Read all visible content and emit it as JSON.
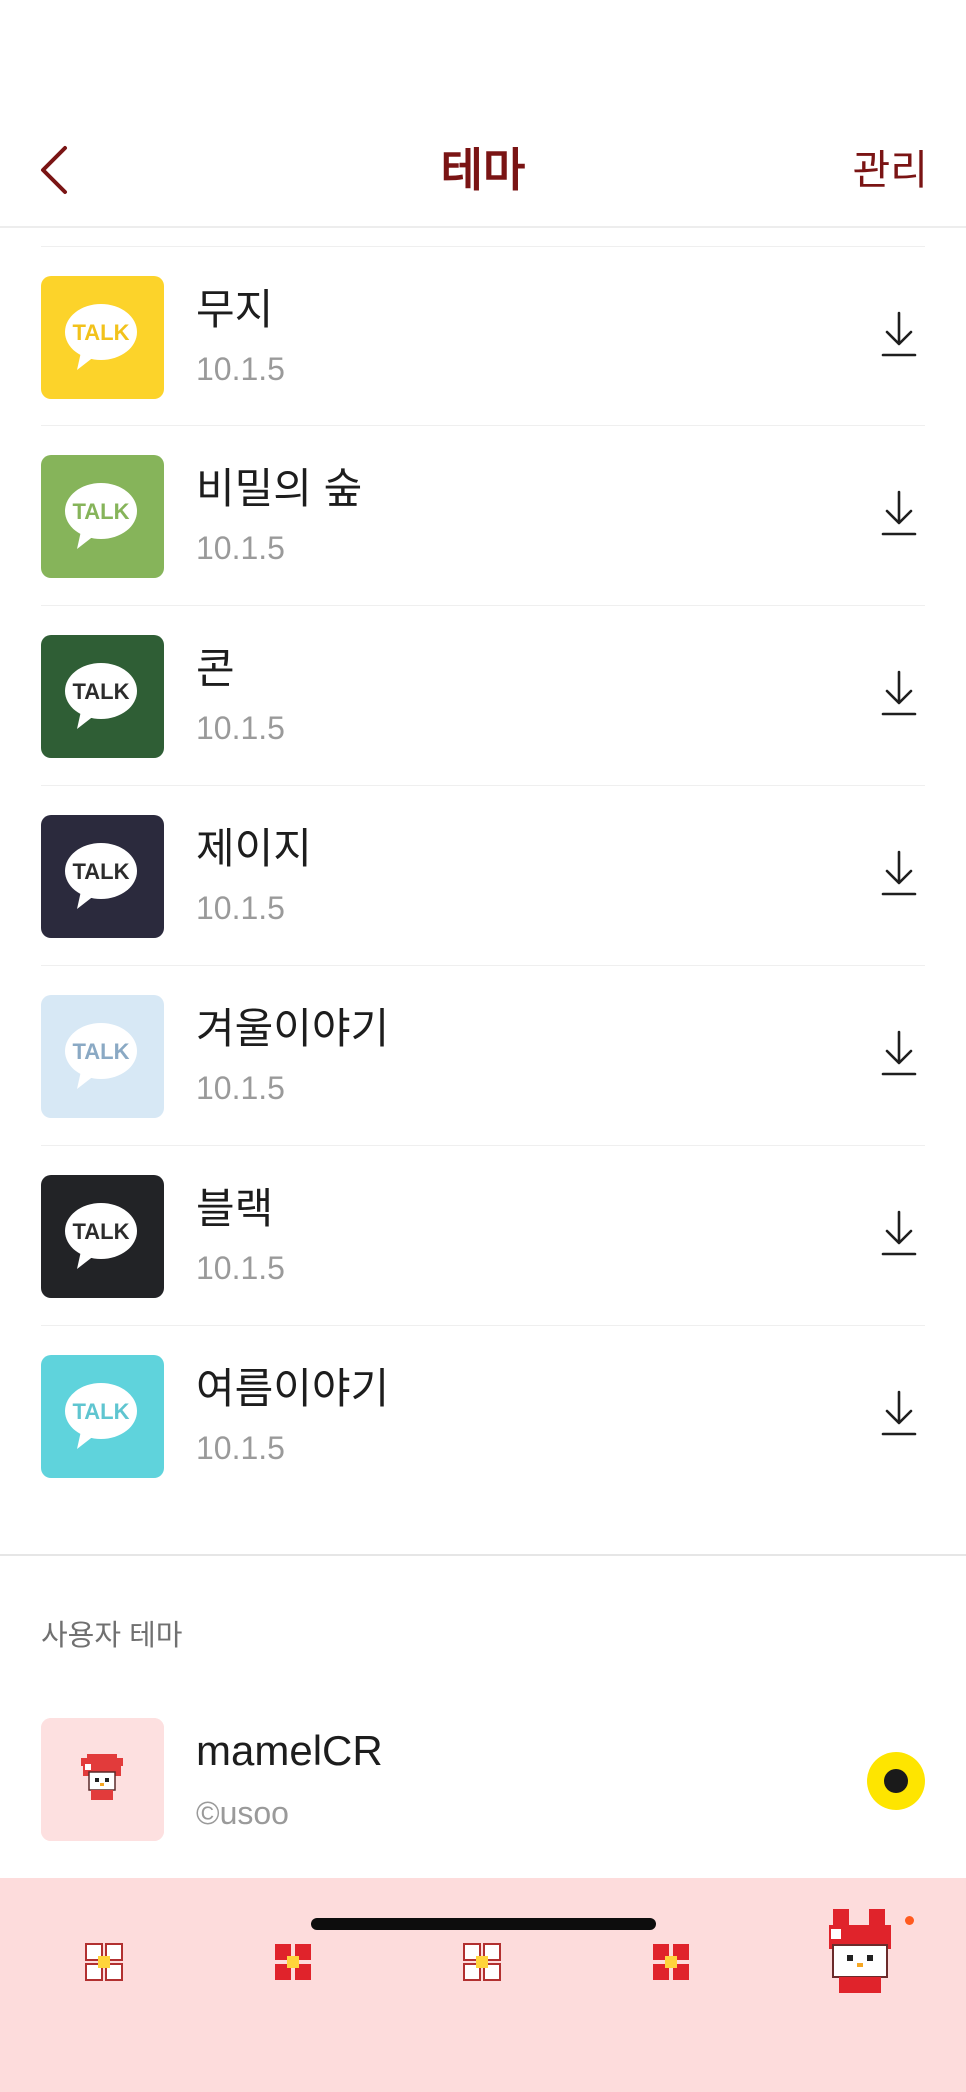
{
  "header": {
    "title": "테마",
    "manage_label": "관리"
  },
  "themes": [
    {
      "name": "무지",
      "version": "10.1.5",
      "bg": "#fcd32a",
      "bubble_text": "TALK",
      "icon": "muzi-theme-icon"
    },
    {
      "name": "비밀의 숲",
      "version": "10.1.5",
      "bg": "#86b45a",
      "bubble_text": "TALK",
      "icon": "secret-forest-theme-icon"
    },
    {
      "name": "콘",
      "version": "10.1.5",
      "bg": "#2f5e35",
      "bubble_text": "TALK",
      "icon": "con-theme-icon"
    },
    {
      "name": "제이지",
      "version": "10.1.5",
      "bg": "#2b2a3d",
      "bubble_text": "TALK",
      "icon": "jayg-theme-icon"
    },
    {
      "name": "겨울이야기",
      "version": "10.1.5",
      "bg": "#d7e8f5",
      "bubble_text": "TALK",
      "icon": "winter-story-theme-icon"
    },
    {
      "name": "블랙",
      "version": "10.1.5",
      "bg": "#222326",
      "bubble_text": "TALK",
      "icon": "black-theme-icon"
    },
    {
      "name": "여름이야기",
      "version": "10.1.5",
      "bg": "#5fd3dc",
      "bubble_text": "TALK",
      "icon": "summer-story-theme-icon"
    }
  ],
  "user_section": {
    "label": "사용자 테마",
    "item": {
      "name": "mamelCR",
      "author": "©usoo",
      "selected": true
    }
  },
  "tabs": [
    {
      "name": "tab-friends",
      "icon": "flower-outline-icon"
    },
    {
      "name": "tab-chats",
      "icon": "flower-red-icon"
    },
    {
      "name": "tab-view",
      "icon": "flower-outline-icon"
    },
    {
      "name": "tab-shopping",
      "icon": "flower-red-icon"
    },
    {
      "name": "tab-more",
      "icon": "mymelody-icon",
      "badge": true
    }
  ],
  "colors": {
    "accent": "#7a1414",
    "tabbar_bg": "#fddcdc",
    "selected": "#fee500",
    "badge": "#ff5a1f"
  }
}
